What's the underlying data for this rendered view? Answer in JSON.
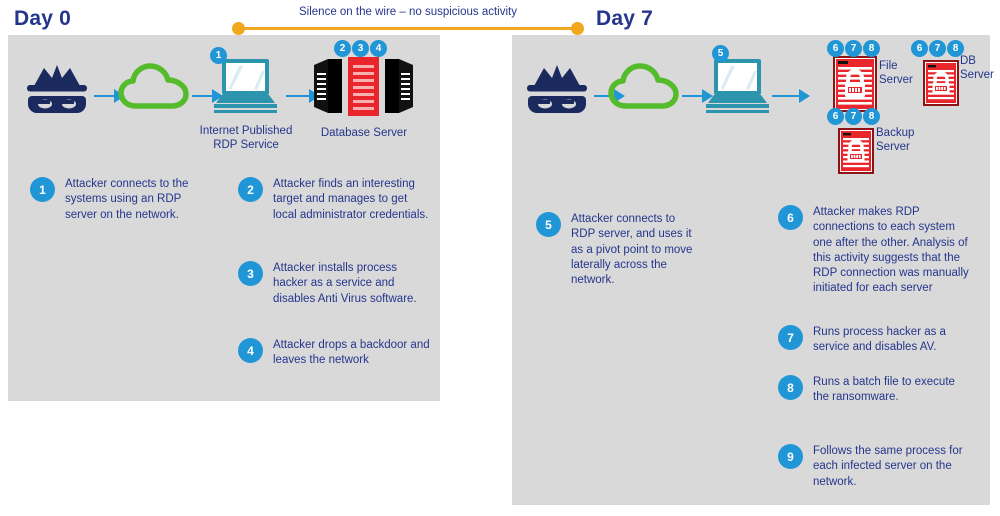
{
  "timeline": {
    "label": "Silence on the wire – no suspicious activity",
    "color": "#f0a81e"
  },
  "theme": {
    "badge_blue": "#2196d6",
    "text_navy": "#24368c",
    "panel_gray": "#d9d9d9",
    "cloud_green": "#54bb2a",
    "laptop_teal": "#2d94ae",
    "server_red": "#e8262b",
    "attacker_navy": "#1b2a5e"
  },
  "day0": {
    "title": "Day 0",
    "icons": {
      "attacker": "attacker-mask-icon",
      "cloud": "cloud-icon",
      "laptop_caption": "Internet Published\nRDP Service",
      "server_caption": "Database Server",
      "laptop_badge": "1",
      "server_badges": [
        "2",
        "3",
        "4"
      ]
    },
    "steps": [
      {
        "num": "1",
        "text": "Attacker connects to the systems using an RDP server on the network."
      },
      {
        "num": "2",
        "text": "Attacker finds an interesting target and manages to get local administrator credentials."
      },
      {
        "num": "3",
        "text": "Attacker installs process hacker as a service and disables Anti Virus software."
      },
      {
        "num": "4",
        "text": "Attacker drops a backdoor and leaves the network"
      }
    ]
  },
  "day7": {
    "title": "Day 7",
    "icons": {
      "attacker": "attacker-mask-icon",
      "cloud": "cloud-icon",
      "laptop_badge": "5",
      "targets": [
        {
          "name": "File\nServer",
          "badges": [
            "6",
            "7",
            "8"
          ]
        },
        {
          "name": "DB\nServer",
          "badges": [
            "6",
            "7",
            "8"
          ]
        },
        {
          "name": "Backup\nServer",
          "badges": [
            "6",
            "7",
            "8"
          ]
        }
      ]
    },
    "steps": [
      {
        "num": "5",
        "text": "Attacker connects to RDP server, and uses it as a pivot point to move laterally across the network."
      },
      {
        "num": "6",
        "text": "Attacker makes RDP connections to each system one after  the other. Analysis of this activity suggests that the RDP connection was manually initiated for each server"
      },
      {
        "num": "7",
        "text": "Runs process hacker as a service and disables AV."
      },
      {
        "num": "8",
        "text": "Runs a batch file to execute the ransomware."
      },
      {
        "num": "9",
        "text": "Follows the same process for each infected server on the network."
      }
    ]
  }
}
